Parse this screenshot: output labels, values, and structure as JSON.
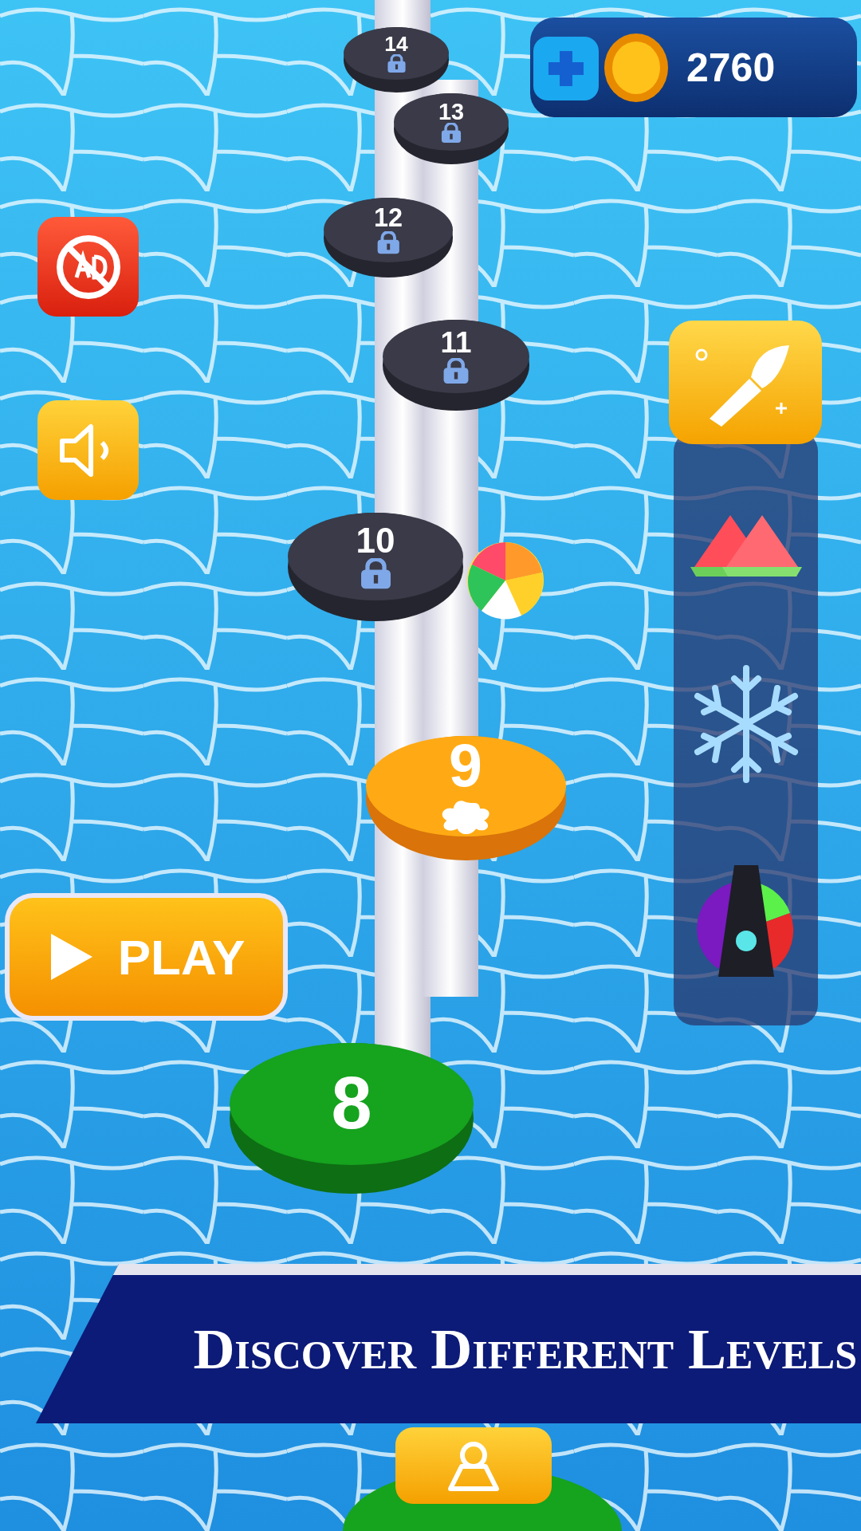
{
  "coins": {
    "amount": "2760"
  },
  "levels": [
    {
      "label": "14",
      "kind": "locked"
    },
    {
      "label": "13",
      "kind": "locked"
    },
    {
      "label": "12",
      "kind": "locked"
    },
    {
      "label": "11",
      "kind": "locked"
    },
    {
      "label": "10",
      "kind": "locked"
    },
    {
      "label": "9",
      "kind": "current"
    },
    {
      "label": "8",
      "kind": "done"
    }
  ],
  "play_button": {
    "label": "PLAY"
  },
  "banner": {
    "text": "Discover Different Levels"
  }
}
